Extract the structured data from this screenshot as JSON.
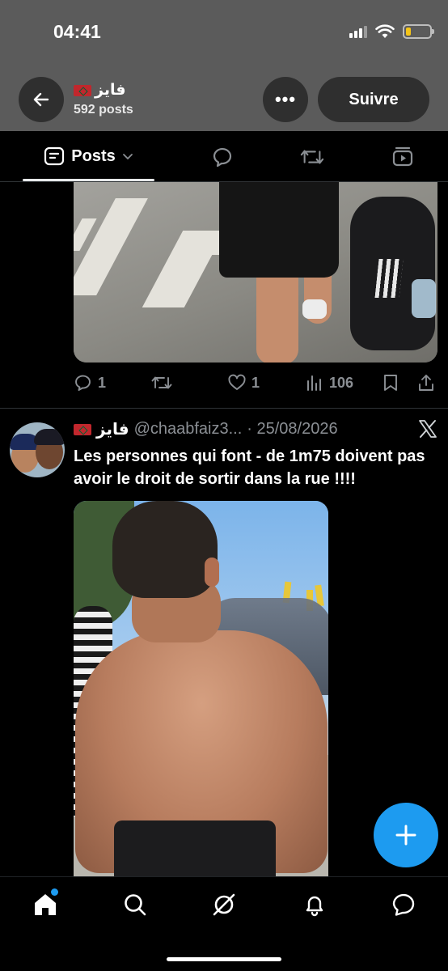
{
  "status_bar": {
    "time": "04:41",
    "icons": [
      "signal-icon",
      "wifi-icon",
      "battery-icon"
    ]
  },
  "header": {
    "profile_name": "فايز",
    "posts_count": "592 posts",
    "more_label": "•••",
    "follow_label": "Suivre"
  },
  "tabs": {
    "posts_label": "Posts",
    "icons": [
      "reply-icon",
      "repost-icon",
      "media-icon"
    ]
  },
  "post1": {
    "replies": "1",
    "likes": "1",
    "views": "106"
  },
  "post2": {
    "name": "فايز",
    "handle": "@chaabfaiz3...",
    "date": "· 25/08/2026",
    "text": "Les personnes qui font - de 1m75 doivent pas avoir le droit de sortir dans la rue !!!!"
  },
  "fab": {
    "label": "+"
  },
  "nav": {
    "items": [
      "home",
      "search",
      "grok",
      "notifications",
      "messages"
    ]
  },
  "colors": {
    "accent": "#1d9bf0",
    "header_bg": "#5b5b5b",
    "muted": "#8b8f94"
  }
}
